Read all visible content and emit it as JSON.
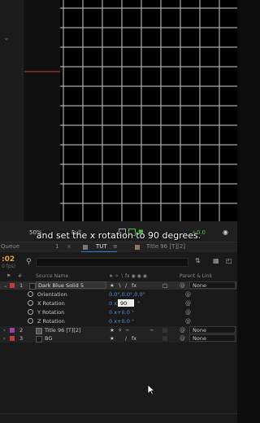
{
  "subtitle": "and set the x rotation to 90 degrees.",
  "viewer_bar": {
    "zoom": "50%",
    "resolution": "Full",
    "exposure": "+0.0"
  },
  "tabs": [
    {
      "label": "Queue"
    },
    {
      "label": "1"
    },
    {
      "label": "TUT"
    },
    {
      "label": "Title 96 [T][2]"
    }
  ],
  "timeline": {
    "timecode": ":02",
    "fps": "0 fps)",
    "headers": {
      "source_name": "Source Name",
      "parent_link": "Parent & Link"
    },
    "layers": [
      {
        "num": "1",
        "name": "Dark Blue Solid 5",
        "color": "#c0393b",
        "parent": "None"
      },
      {
        "num": "2",
        "name": "Title 96 [T][2]",
        "color": "#9b3fb0",
        "parent": "None"
      },
      {
        "num": "3",
        "name": "BG",
        "color": "#c0393b",
        "parent": "None"
      }
    ],
    "properties": [
      {
        "name": "Orientation",
        "value": "0.0°,0.0°,0.0°"
      },
      {
        "name": "X Rotation",
        "prefix": "0 x",
        "value": "90",
        "suffix": "°"
      },
      {
        "name": "Y Rotation",
        "value": "0 x+0.0 °"
      },
      {
        "name": "Z Rotation",
        "value": "0 x+0.0 °"
      }
    ]
  }
}
